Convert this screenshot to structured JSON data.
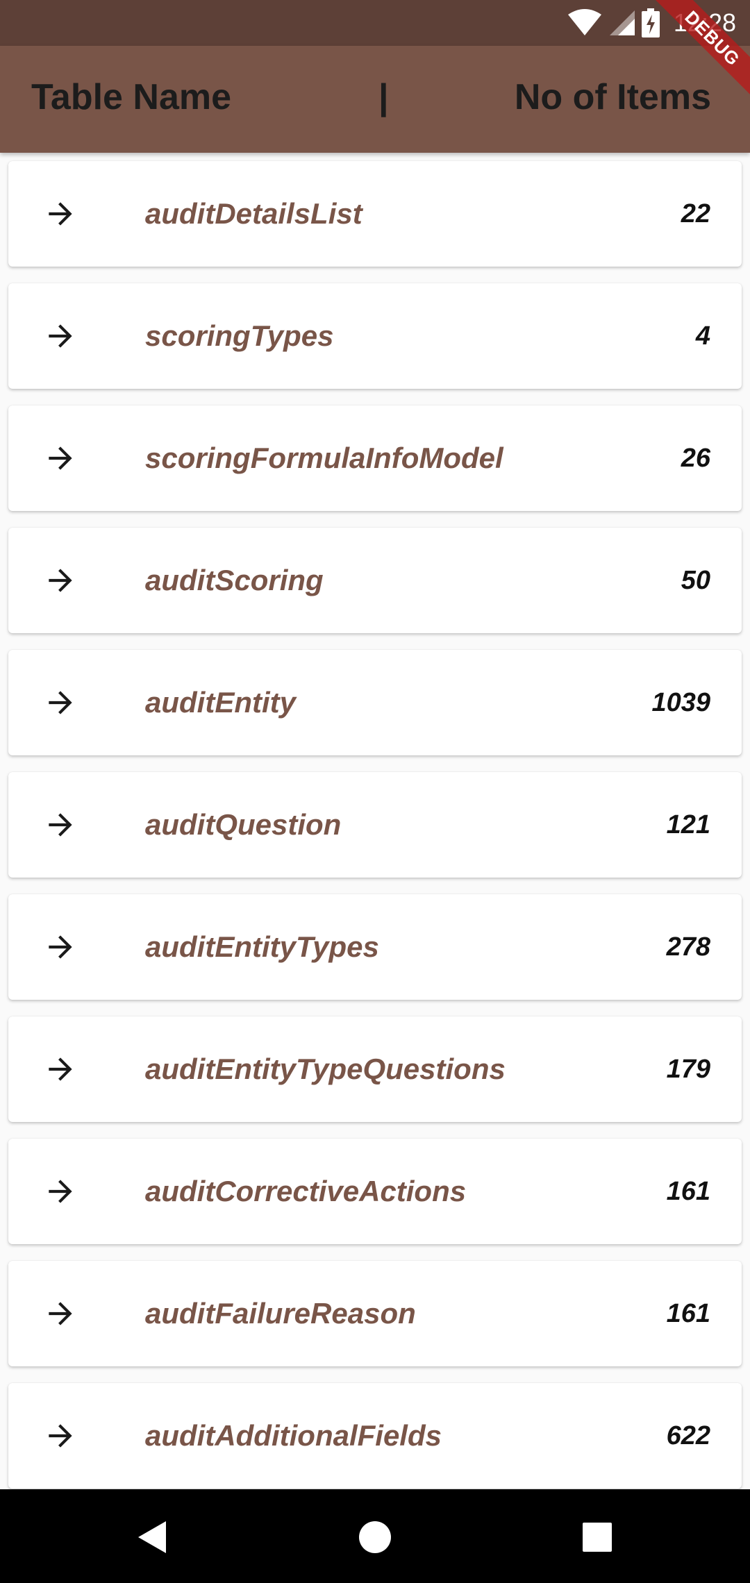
{
  "status_bar": {
    "time": "12:28",
    "icons": [
      "wifi-icon",
      "signal-icon",
      "battery-charging-icon"
    ]
  },
  "debug_banner": "DEBUG",
  "header": {
    "title": "Table Name",
    "separator": "|",
    "count_label": "No of Items"
  },
  "tables": [
    {
      "name": "auditDetailsList",
      "count": "22"
    },
    {
      "name": "scoringTypes",
      "count": "4"
    },
    {
      "name": "scoringFormulaInfoModel",
      "count": "26"
    },
    {
      "name": "auditScoring",
      "count": "50"
    },
    {
      "name": "auditEntity",
      "count": "1039"
    },
    {
      "name": "auditQuestion",
      "count": "121"
    },
    {
      "name": "auditEntityTypes",
      "count": "278"
    },
    {
      "name": "auditEntityTypeQuestions",
      "count": "179"
    },
    {
      "name": "auditCorrectiveActions",
      "count": "161"
    },
    {
      "name": "auditFailureReason",
      "count": "161"
    },
    {
      "name": "auditAdditionalFields",
      "count": "622"
    }
  ],
  "nav_bar": {
    "icons": [
      "back-icon",
      "home-icon",
      "recents-icon"
    ]
  },
  "colors": {
    "status_bar": "#5d4037",
    "app_bar": "#795548",
    "accent_text": "#795548",
    "background": "#fafafa"
  }
}
